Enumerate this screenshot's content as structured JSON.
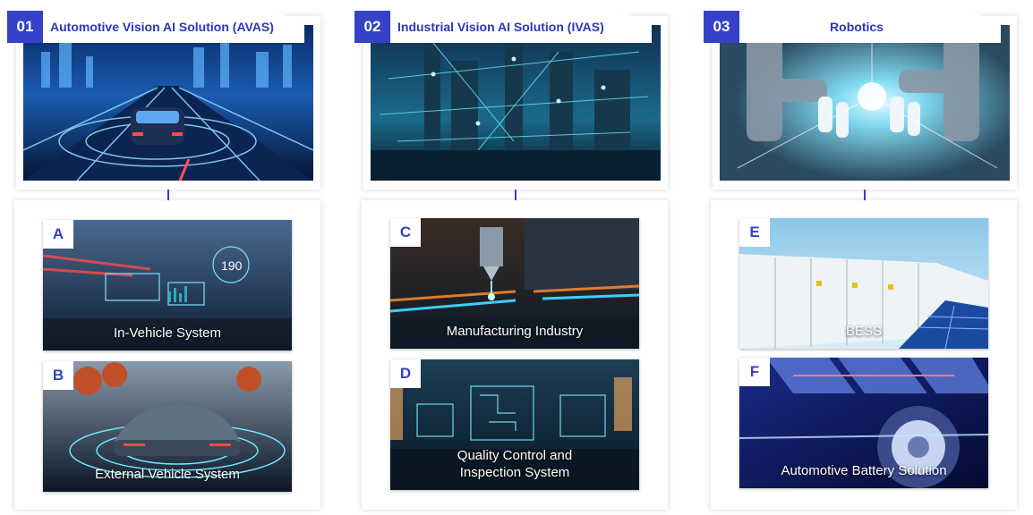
{
  "columns": [
    {
      "number": "01",
      "title": "Automotive Vision AI Solution (AVAS)",
      "image_icon": "smart-road-scene",
      "subs": [
        {
          "letter": "A",
          "label": "In-Vehicle System",
          "speed": "190",
          "image_icon": "dashboard-hud"
        },
        {
          "letter": "B",
          "label": "External Vehicle System",
          "image_icon": "car-sensor-rings"
        }
      ]
    },
    {
      "number": "02",
      "title": "Industrial Vision AI Solution (IVAS)",
      "image_icon": "industrial-plant",
      "subs": [
        {
          "letter": "C",
          "label": "Manufacturing Industry",
          "image_icon": "cnc-laser"
        },
        {
          "letter": "D",
          "label_line1": "Quality Control and",
          "label_line2": "Inspection System",
          "image_icon": "circuit-boxes"
        }
      ]
    },
    {
      "number": "03",
      "title": "Robotics",
      "image_icon": "robot-arms",
      "subs": [
        {
          "letter": "E",
          "label": "BESS",
          "image_icon": "battery-containers"
        },
        {
          "letter": "F",
          "label": "Automotive Battery Solution",
          "image_icon": "battery-cells"
        }
      ]
    }
  ],
  "colors": {
    "accent": "#3441c8",
    "title_text": "#2b38b8"
  }
}
